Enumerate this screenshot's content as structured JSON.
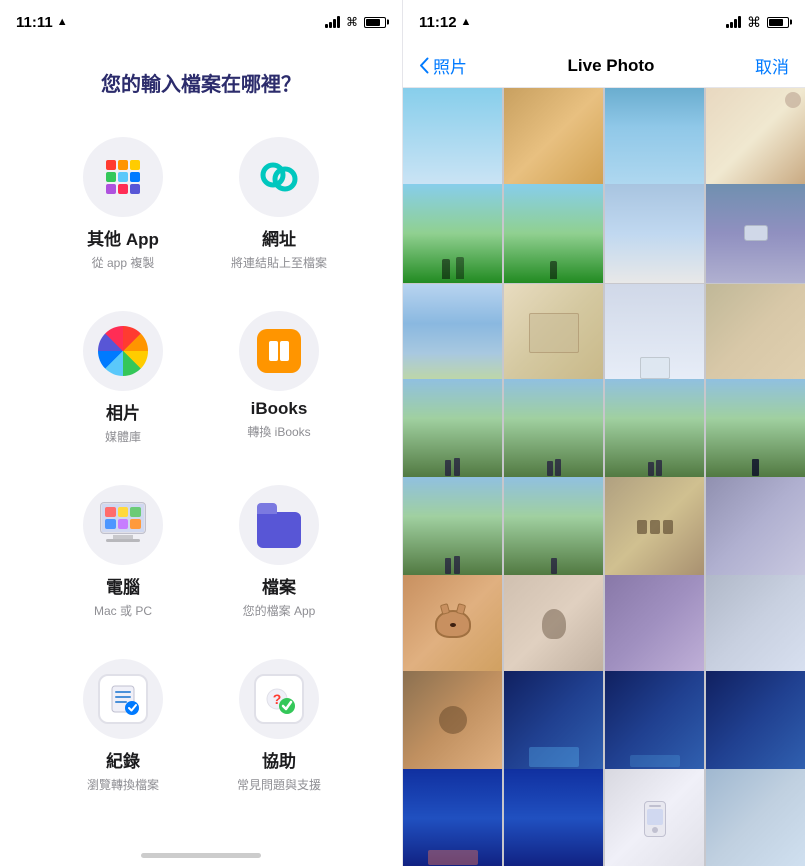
{
  "left": {
    "statusBar": {
      "time": "11:11",
      "locationIcon": "▲"
    },
    "title": "您的輸入檔案在哪裡？",
    "apps": [
      {
        "id": "other-app",
        "label": "其他 App",
        "sublabel": "從 app 複製",
        "iconType": "grid"
      },
      {
        "id": "url",
        "label": "網址",
        "sublabel": "將連結貼上至檔案",
        "iconType": "link"
      },
      {
        "id": "photos",
        "label": "相片",
        "sublabel": "媒體庫",
        "iconType": "photos"
      },
      {
        "id": "ibooks",
        "label": "iBooks",
        "sublabel": "轉換 iBooks",
        "iconType": "ibooks"
      },
      {
        "id": "computer",
        "label": "電腦",
        "sublabel": "Mac 或 PC",
        "iconType": "computer"
      },
      {
        "id": "files",
        "label": "檔案",
        "sublabel": "您的檔案 App",
        "iconType": "folder"
      },
      {
        "id": "records",
        "label": "紀錄",
        "sublabel": "瀏覽轉換檔案",
        "iconType": "records"
      },
      {
        "id": "help",
        "label": "協助",
        "sublabel": "常見問題與支援",
        "iconType": "help"
      }
    ]
  },
  "right": {
    "statusBar": {
      "time": "11:12",
      "locationIcon": "▲"
    },
    "nav": {
      "backLabel": "照片",
      "title": "Live Photo",
      "cancelLabel": "取消"
    },
    "photos": [
      {
        "color": "ph-sky",
        "row": 1,
        "hasLive": false
      },
      {
        "color": "ph-food",
        "row": 1,
        "hasLive": false
      },
      {
        "color": "ph-sky",
        "row": 1,
        "hasLive": false
      },
      {
        "color": "ph-cat",
        "row": 1,
        "hasLive": false
      },
      {
        "color": "ph-park",
        "row": 2,
        "hasLive": true
      },
      {
        "color": "ph-park",
        "row": 2,
        "hasLive": true
      },
      {
        "color": "ph-dark",
        "row": 2,
        "hasLive": false
      },
      {
        "color": "ph-cat",
        "row": 2,
        "hasLive": false
      },
      {
        "color": "ph-lake",
        "row": 3,
        "hasLive": false
      },
      {
        "color": "ph-map",
        "row": 3,
        "hasLive": false
      },
      {
        "color": "ph-white",
        "row": 3,
        "hasLive": false
      },
      {
        "color": "ph-building",
        "row": 3,
        "hasLive": false
      },
      {
        "color": "ph-group",
        "row": 4,
        "hasLive": true
      },
      {
        "color": "ph-group",
        "row": 4,
        "hasLive": true
      },
      {
        "color": "ph-group",
        "row": 4,
        "hasLive": true
      },
      {
        "color": "ph-group",
        "row": 4,
        "hasLive": true
      },
      {
        "color": "ph-group",
        "row": 5,
        "hasLive": true
      },
      {
        "color": "ph-group",
        "row": 5,
        "hasLive": true
      },
      {
        "color": "ph-group",
        "row": 5,
        "hasLive": true
      },
      {
        "color": "ph-group",
        "row": 5,
        "hasLive": true
      },
      {
        "color": "ph-orange",
        "row": 6,
        "hasLive": true
      },
      {
        "color": "ph-people",
        "row": 6,
        "hasLive": false
      },
      {
        "color": "ph-cat",
        "row": 6,
        "hasLive": false
      },
      {
        "color": "ph-indoor",
        "row": 6,
        "hasLive": false
      },
      {
        "color": "ph-selfie",
        "row": 7,
        "hasLive": false
      },
      {
        "color": "ph-stage",
        "row": 7,
        "hasLive": false
      },
      {
        "color": "ph-stage",
        "row": 7,
        "hasLive": false
      },
      {
        "color": "ph-stage",
        "row": 7,
        "hasLive": false
      },
      {
        "color": "ph-stage",
        "row": 8,
        "hasLive": false
      },
      {
        "color": "ph-stage",
        "row": 8,
        "hasLive": false
      },
      {
        "color": "ph-phone",
        "row": 8,
        "hasLive": false
      },
      {
        "color": "ph-room",
        "row": 8,
        "hasLive": false
      }
    ]
  }
}
